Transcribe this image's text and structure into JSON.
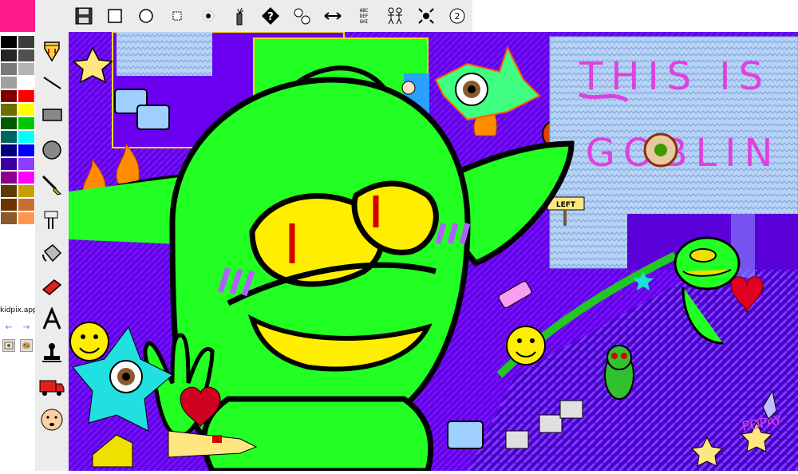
{
  "app": {
    "site": "kidpix.app"
  },
  "palette": {
    "current": "#ff1a8c",
    "colors": [
      "#000000",
      "#3c3c3c",
      "#262626",
      "#505050",
      "#7a7a7a",
      "#b4b4b4",
      "#a0a0a0",
      "#ffffff",
      "#800000",
      "#ff0000",
      "#6e6e00",
      "#ffff00",
      "#005a00",
      "#00c800",
      "#006464",
      "#00ffff",
      "#000080",
      "#0000ff",
      "#3c00a0",
      "#8c3cff",
      "#8c008c",
      "#ff00ff",
      "#5a3c00",
      "#c8a000",
      "#6e3200",
      "#c86e32",
      "#8c5a28",
      "#ff9650"
    ]
  },
  "nav": {
    "back": "←",
    "forward": "→"
  },
  "tools": [
    {
      "name": "pencil-tool",
      "icon": "pencil-icon"
    },
    {
      "name": "line-tool",
      "icon": "line-icon"
    },
    {
      "name": "rectangle-tool",
      "icon": "rectangle-icon"
    },
    {
      "name": "oval-tool",
      "icon": "oval-icon"
    },
    {
      "name": "paint-brush-tool",
      "icon": "paintbrush-icon"
    },
    {
      "name": "mixer-tool",
      "icon": "mixer-icon"
    },
    {
      "name": "paint-bucket-tool",
      "icon": "bucket-icon"
    },
    {
      "name": "eraser-tool",
      "icon": "eraser-icon"
    },
    {
      "name": "text-tool",
      "icon": "letter-a-icon"
    },
    {
      "name": "stamp-tool",
      "icon": "stamp-icon"
    },
    {
      "name": "moving-van-tool",
      "icon": "truck-icon"
    },
    {
      "name": "undo-guy-tool",
      "icon": "face-icon"
    }
  ],
  "toolbar": {
    "abc_label": "ABC DEF GHI",
    "buttons": [
      "save-icon",
      "square-brush-icon",
      "round-brush-icon",
      "small-square-brush-icon",
      "dot-brush-icon",
      "firecracker-icon",
      "mystery-icon",
      "bubbles-icon",
      "arrows-icon",
      "alphabet-icon",
      "people-icon",
      "explode-icon",
      "number-2-icon"
    ],
    "number_two": "2"
  },
  "canvas": {
    "title_line1": "THIS IS",
    "title_line2": "GOBLIN",
    "left_sign": "LEFT",
    "scribble": "POPAY",
    "colors": {
      "background": "#6d00ff",
      "goblin": "#22ff22",
      "eye": "#ffee00",
      "blush": "#b060ff",
      "sign_bg": "#c6dcff",
      "letters": "#e040e0"
    }
  }
}
